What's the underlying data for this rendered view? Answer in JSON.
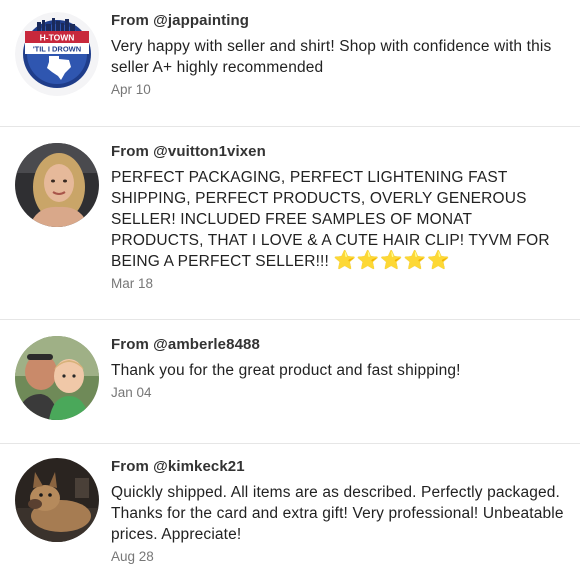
{
  "reviews": [
    {
      "from": "From @jappainting",
      "text": "Very happy with seller and shirt! Shop with confidence with this seller A+ highly recommended",
      "date": "Apr 10",
      "avatar": {
        "kind": "logo",
        "logo_top": "H-TOWN",
        "logo_bottom": "'TIL I DROWN",
        "colors": {
          "ring": "#1f3d8a",
          "band": "#c8283c",
          "bg": "#ffffff"
        }
      }
    },
    {
      "from": "From @vuitton1vixen",
      "text": "PERFECT PACKAGING, PERFECT LIGHTENING FAST SHIPPING, PERFECT PRODUCTS, OVERLY GENEROUS SELLER! INCLUDED FREE SAMPLES OF MONAT PRODUCTS, THAT I LOVE & A CUTE HAIR CLIP! TYVM FOR BEING A PERFECT SELLER!!!",
      "stars": "⭐⭐⭐⭐⭐",
      "date": "Mar 18",
      "avatar": {
        "kind": "photo",
        "subject": "woman-portrait"
      }
    },
    {
      "from": "From @amberle8488",
      "text": "Thank you for the great product and fast shipping!",
      "date": "Jan 04",
      "avatar": {
        "kind": "photo",
        "subject": "adult-with-child"
      }
    },
    {
      "from": "From @kimkeck21",
      "text": "Quickly shipped. All items are as described. Perfectly packaged. Thanks for the card and extra gift! Very professional! Unbeatable prices. Appreciate!",
      "date": "Aug 28",
      "avatar": {
        "kind": "photo",
        "subject": "dog"
      }
    }
  ],
  "colors": {
    "from_text": "#333333",
    "body_text": "#222222",
    "date_text": "#777777",
    "divider": "#e6e6e6",
    "star": "#f5c518"
  }
}
